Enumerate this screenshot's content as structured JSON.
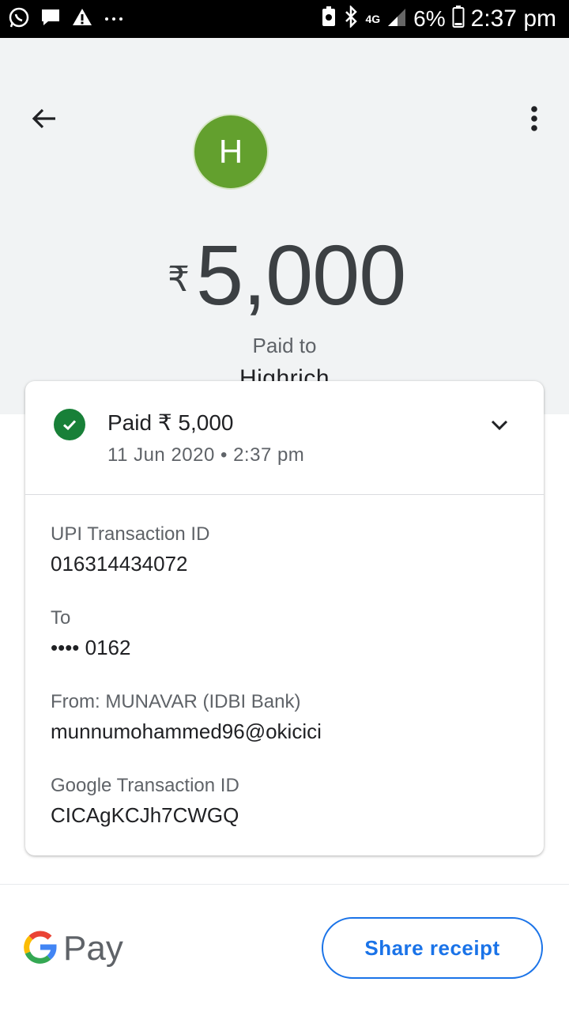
{
  "status_bar": {
    "left_icons": [
      "whatsapp-icon",
      "chat-icon",
      "warning-icon",
      "more-dots-icon"
    ],
    "right_icons": [
      "battery-saver-icon",
      "bluetooth-icon",
      "network-4g-icon",
      "signal-icon",
      "battery-icon"
    ],
    "network_label": "4G",
    "battery": "6%",
    "time": "2:37 pm"
  },
  "header": {
    "avatar_letter": "H",
    "avatar_color": "#63a02e",
    "currency_symbol": "₹",
    "amount": "5,000",
    "paid_to_label": "Paid to",
    "payee_name": "Highrich"
  },
  "card": {
    "status_title": "Paid ₹ 5,000",
    "status_date": "11 Jun 2020 • 2:37 pm",
    "status_color": "#188038",
    "details": [
      {
        "label": "UPI Transaction ID",
        "value": "016314434072"
      },
      {
        "label": "To",
        "value": "•••• 0162"
      },
      {
        "label": "From: MUNAVAR (IDBI Bank)",
        "value": "munnumohammed96@okicici"
      },
      {
        "label": "Google Transaction ID",
        "value": "CICAgKCJh7CWGQ"
      }
    ]
  },
  "footer": {
    "logo_text": "Pay",
    "share_label": "Share receipt",
    "accent_color": "#1a73e8"
  }
}
